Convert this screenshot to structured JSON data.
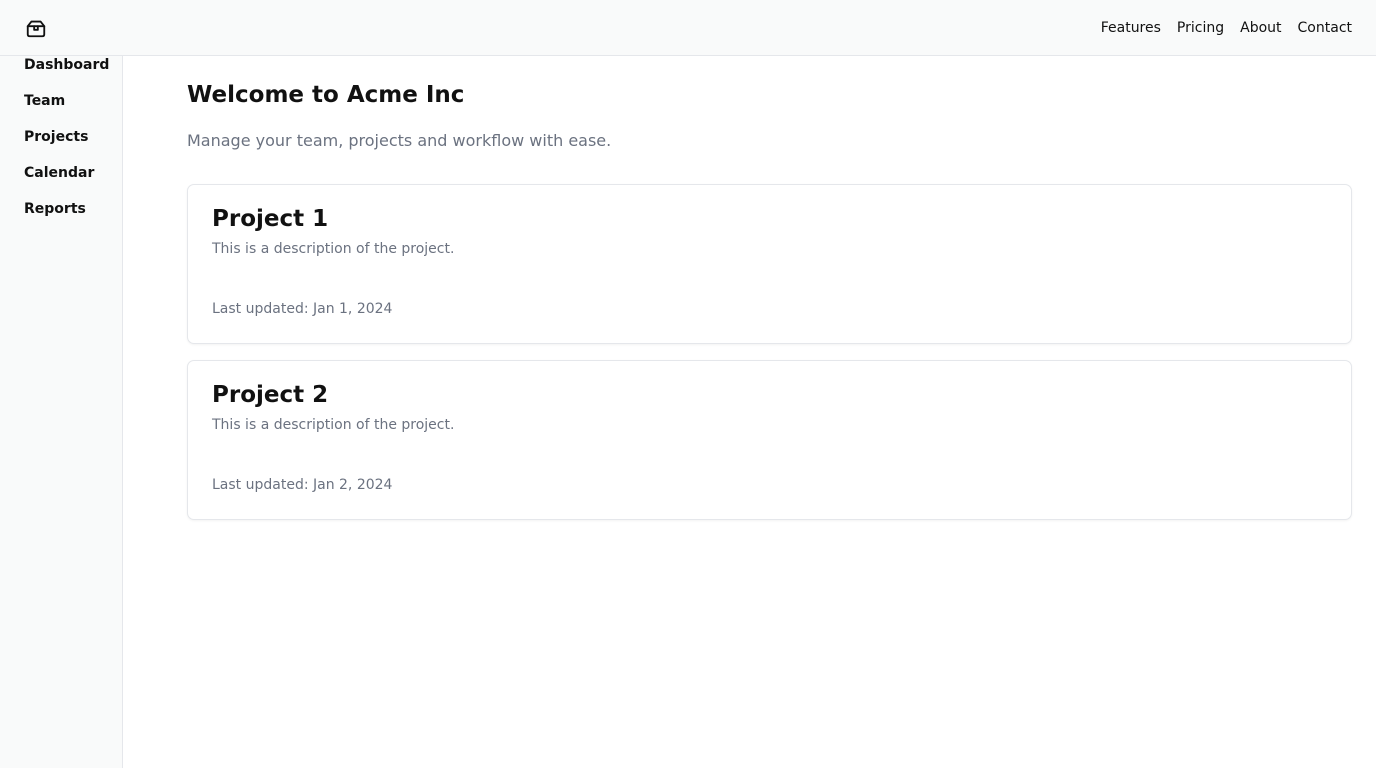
{
  "header": {
    "logo_icon": "package-icon",
    "nav": [
      {
        "label": "Features"
      },
      {
        "label": "Pricing"
      },
      {
        "label": "About"
      },
      {
        "label": "Contact"
      }
    ]
  },
  "sidebar": {
    "items": [
      {
        "label": "Dashboard"
      },
      {
        "label": "Team"
      },
      {
        "label": "Projects"
      },
      {
        "label": "Calendar"
      },
      {
        "label": "Reports"
      }
    ]
  },
  "main": {
    "title": "Welcome to Acme Inc",
    "subtitle": "Manage your team, projects and workflow with ease.",
    "projects": [
      {
        "title": "Project 1",
        "description": "This is a description of the project.",
        "updated": "Last updated: Jan 1, 2024"
      },
      {
        "title": "Project 2",
        "description": "This is a description of the project.",
        "updated": "Last updated: Jan 2, 2024"
      }
    ]
  },
  "colors": {
    "background": "#ffffff",
    "chrome": "#f9fafa",
    "border": "#e5e7eb",
    "text": "#111111",
    "muted": "#6b7280"
  }
}
